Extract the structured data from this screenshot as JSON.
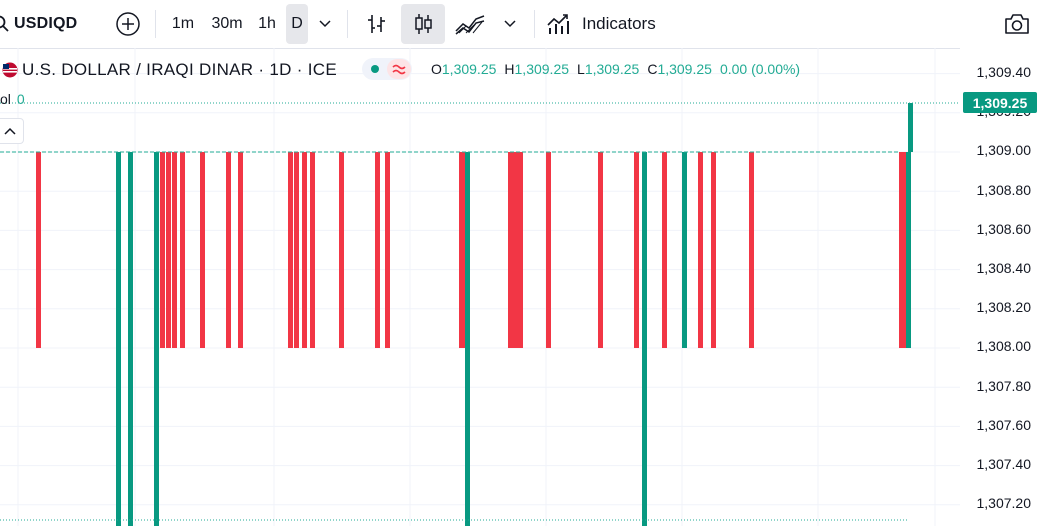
{
  "toolbar": {
    "symbol": "USDIQD",
    "intervals": [
      "1m",
      "30m",
      "1h",
      "D"
    ],
    "indicators_label": "Indicators",
    "icons": [
      "search-icon",
      "add-symbol-icon",
      "chevron-down-icon",
      "bar-chart-icon",
      "candles-icon",
      "area-chart-icon",
      "chevron-down-icon",
      "indicators-icon",
      "camera-icon"
    ]
  },
  "legend": {
    "title": "U.S. DOLLAR / IRAQI DINAR · 1D · ICE",
    "open_label": "O",
    "open": "1,309.25",
    "high_label": "H",
    "high": "1,309.25",
    "low_label": "L",
    "low": "1,309.25",
    "close_label": "C",
    "close": "1,309.25",
    "change": "0.00 (0.00%)",
    "vol_label": "ol",
    "vol_value": "0"
  },
  "axis": {
    "last_price": "1,309.25",
    "ticks": [
      "1,309.40",
      "1,309.20",
      "1,309.00",
      "1,308.80",
      "1,308.60",
      "1,308.40",
      "1,308.20",
      "1,308.00",
      "1,307.80",
      "1,307.60",
      "1,307.40",
      "1,307.20"
    ]
  },
  "colors": {
    "up": "#089981",
    "down": "#f23645",
    "price_line": "#22ab94"
  },
  "chart_data": {
    "type": "bar",
    "series": [
      {
        "values": [
          {
            "dir": "down",
            "open": 1309.0,
            "close": 1308.0
          },
          {
            "dir": "up",
            "open": 1307.0,
            "close": 1309.0
          },
          {
            "dir": "up",
            "open": 1307.0,
            "close": 1309.0
          },
          {
            "dir": "up",
            "open": 1307.0,
            "close": 1309.0
          },
          {
            "dir": "down",
            "open": 1309.0,
            "close": 1308.0
          },
          {
            "dir": "down",
            "open": 1309.0,
            "close": 1308.0
          },
          {
            "dir": "down",
            "open": 1309.0,
            "close": 1308.0
          },
          {
            "dir": "down",
            "open": 1309.0,
            "close": 1308.0
          },
          {
            "dir": "down",
            "open": 1309.0,
            "close": 1308.0
          },
          {
            "dir": "down",
            "open": 1309.0,
            "close": 1308.0
          },
          {
            "dir": "down",
            "open": 1309.0,
            "close": 1308.0
          },
          {
            "dir": "down",
            "open": 1309.0,
            "close": 1308.0
          },
          {
            "dir": "down",
            "open": 1309.0,
            "close": 1308.0
          },
          {
            "dir": "down",
            "open": 1309.0,
            "close": 1308.0
          },
          {
            "dir": "down",
            "open": 1309.0,
            "close": 1308.0
          },
          {
            "dir": "down",
            "open": 1309.0,
            "close": 1308.0
          },
          {
            "dir": "down",
            "open": 1309.0,
            "close": 1308.0
          },
          {
            "dir": "down",
            "open": 1309.0,
            "close": 1308.0
          },
          {
            "dir": "down",
            "open": 1309.0,
            "close": 1308.0
          },
          {
            "dir": "down",
            "open": 1309.0,
            "close": 1308.0
          },
          {
            "dir": "up",
            "open": 1307.0,
            "close": 1309.0
          },
          {
            "dir": "down",
            "open": 1309.0,
            "close": 1308.0
          },
          {
            "dir": "down",
            "open": 1309.0,
            "close": 1308.0
          },
          {
            "dir": "down",
            "open": 1309.0,
            "close": 1308.0
          },
          {
            "dir": "down",
            "open": 1309.0,
            "close": 1308.0
          },
          {
            "dir": "down",
            "open": 1309.0,
            "close": 1308.0
          },
          {
            "dir": "down",
            "open": 1309.0,
            "close": 1308.0
          },
          {
            "dir": "up",
            "open": 1307.0,
            "close": 1309.0
          },
          {
            "dir": "down",
            "open": 1309.0,
            "close": 1308.0
          },
          {
            "dir": "up",
            "open": 1308.0,
            "close": 1309.0
          },
          {
            "dir": "down",
            "open": 1309.0,
            "close": 1308.0
          },
          {
            "dir": "down",
            "open": 1309.0,
            "close": 1308.0
          },
          {
            "dir": "down",
            "open": 1309.0,
            "close": 1308.0
          },
          {
            "dir": "down",
            "open": 1309.0,
            "close": 1308.0
          },
          {
            "dir": "down",
            "open": 1309.0,
            "close": 1308.0
          },
          {
            "dir": "up",
            "open": 1308.0,
            "close": 1309.0
          },
          {
            "dir": "up",
            "open": 1309.0,
            "close": 1309.25
          }
        ]
      }
    ],
    "ylim": [
      1307.1,
      1309.5
    ],
    "last_close": 1309.25,
    "grid": true
  }
}
